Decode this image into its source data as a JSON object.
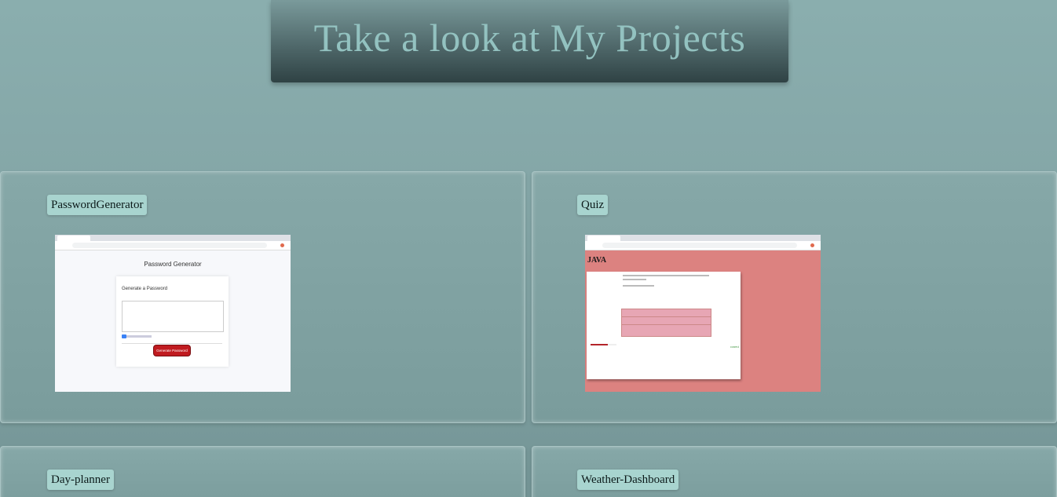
{
  "header": {
    "title": "Take a look at My Projects"
  },
  "projects": [
    {
      "label": "PasswordGenerator",
      "preview": {
        "title": "Password Generator",
        "subtitle": "Generate a Password",
        "button": "Generate Password"
      }
    },
    {
      "label": "Quiz",
      "preview": {
        "title": "JAVA",
        "status": "correct"
      }
    },
    {
      "label": "Day-planner"
    },
    {
      "label": "Weather-Dashboard"
    }
  ],
  "colors": {
    "background": "#84a6a7",
    "header_text": "#93c2c0",
    "label_bg": "#a8d4cf",
    "quiz_bg": "#dc8280"
  }
}
